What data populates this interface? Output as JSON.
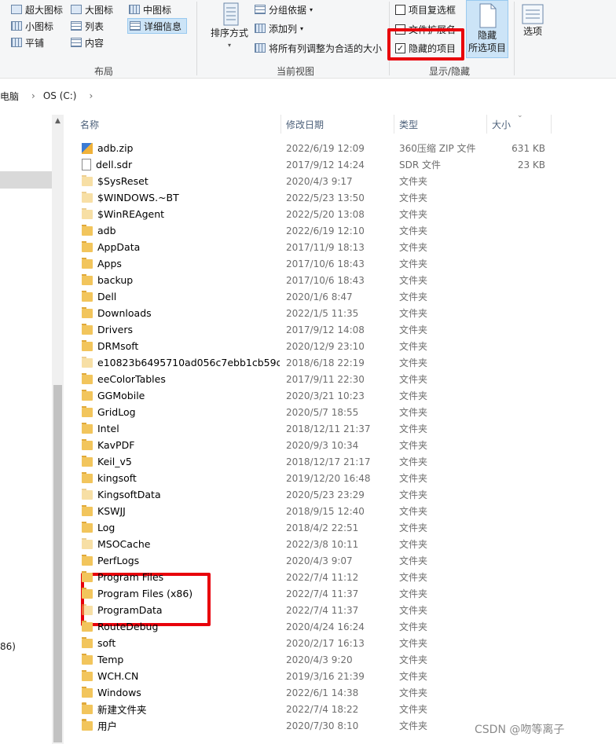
{
  "ribbon": {
    "layout": {
      "items": [
        "超大图标",
        "大图标",
        "中图标",
        "小图标",
        "列表",
        "详细信息",
        "平铺",
        "内容"
      ],
      "group_label": "布局"
    },
    "current_view": {
      "sort_label": "排序方式",
      "group_by": "分组依据",
      "add_column": "添加列",
      "fit_columns": "将所有列调整为合适的大小",
      "group_label": "当前视图"
    },
    "show_hide": {
      "item_checkboxes": "项目复选框",
      "file_extensions": "文件扩展名",
      "hidden_items": "隐藏的项目",
      "hidden_items_checked": "✓",
      "hide_selected_line1": "隐藏",
      "hide_selected_line2": "所选项目",
      "group_label": "显示/隐藏"
    },
    "options": "选项"
  },
  "address": {
    "crumbs": [
      "此电脑",
      "OS (C:)"
    ],
    "separator": "›"
  },
  "nav": {
    "partial_label": "86)"
  },
  "columns": {
    "name": "名称",
    "date": "修改日期",
    "type": "类型",
    "size": "大小"
  },
  "files": [
    {
      "name": "adb.zip",
      "date": "2022/6/19 12:09",
      "type": "360压缩 ZIP 文件",
      "size": "631 KB",
      "icon": "zip-icon"
    },
    {
      "name": "dell.sdr",
      "date": "2017/9/12 14:24",
      "type": "SDR 文件",
      "size": "23 KB",
      "icon": "file-icon"
    },
    {
      "name": "$SysReset",
      "date": "2020/4/3 9:17",
      "type": "文件夹",
      "size": "",
      "icon": "hidden-folder-icon"
    },
    {
      "name": "$WINDOWS.~BT",
      "date": "2022/5/23 13:50",
      "type": "文件夹",
      "size": "",
      "icon": "hidden-folder-icon"
    },
    {
      "name": "$WinREAgent",
      "date": "2022/5/20 13:08",
      "type": "文件夹",
      "size": "",
      "icon": "hidden-folder-icon"
    },
    {
      "name": "adb",
      "date": "2022/6/19 12:10",
      "type": "文件夹",
      "size": "",
      "icon": "folder-icon"
    },
    {
      "name": "AppData",
      "date": "2017/11/9 18:13",
      "type": "文件夹",
      "size": "",
      "icon": "folder-icon"
    },
    {
      "name": "Apps",
      "date": "2017/10/6 18:43",
      "type": "文件夹",
      "size": "",
      "icon": "folder-icon"
    },
    {
      "name": "backup",
      "date": "2017/10/6 18:43",
      "type": "文件夹",
      "size": "",
      "icon": "folder-icon"
    },
    {
      "name": "Dell",
      "date": "2020/1/6 8:47",
      "type": "文件夹",
      "size": "",
      "icon": "folder-icon"
    },
    {
      "name": "Downloads",
      "date": "2022/1/5 11:35",
      "type": "文件夹",
      "size": "",
      "icon": "folder-icon"
    },
    {
      "name": "Drivers",
      "date": "2017/9/12 14:08",
      "type": "文件夹",
      "size": "",
      "icon": "folder-icon"
    },
    {
      "name": "DRMsoft",
      "date": "2020/12/9 23:10",
      "type": "文件夹",
      "size": "",
      "icon": "folder-icon"
    },
    {
      "name": "e10823b6495710ad056c7ebb1cb59d...",
      "date": "2018/6/18 22:19",
      "type": "文件夹",
      "size": "",
      "icon": "hidden-folder-icon"
    },
    {
      "name": "eeColorTables",
      "date": "2017/9/11 22:30",
      "type": "文件夹",
      "size": "",
      "icon": "folder-icon"
    },
    {
      "name": "GGMobile",
      "date": "2020/3/21 10:23",
      "type": "文件夹",
      "size": "",
      "icon": "folder-icon"
    },
    {
      "name": "GridLog",
      "date": "2020/5/7 18:55",
      "type": "文件夹",
      "size": "",
      "icon": "folder-icon"
    },
    {
      "name": "Intel",
      "date": "2018/12/11 21:37",
      "type": "文件夹",
      "size": "",
      "icon": "folder-icon"
    },
    {
      "name": "KavPDF",
      "date": "2020/9/3 10:34",
      "type": "文件夹",
      "size": "",
      "icon": "folder-icon"
    },
    {
      "name": "Keil_v5",
      "date": "2018/12/17 21:17",
      "type": "文件夹",
      "size": "",
      "icon": "folder-icon"
    },
    {
      "name": "kingsoft",
      "date": "2019/12/20 16:48",
      "type": "文件夹",
      "size": "",
      "icon": "folder-icon"
    },
    {
      "name": "KingsoftData",
      "date": "2020/5/23 23:29",
      "type": "文件夹",
      "size": "",
      "icon": "hidden-folder-icon"
    },
    {
      "name": "KSWJJ",
      "date": "2018/9/15 12:40",
      "type": "文件夹",
      "size": "",
      "icon": "folder-icon"
    },
    {
      "name": "Log",
      "date": "2018/4/2 22:51",
      "type": "文件夹",
      "size": "",
      "icon": "folder-icon"
    },
    {
      "name": "MSOCache",
      "date": "2022/3/8 10:11",
      "type": "文件夹",
      "size": "",
      "icon": "hidden-folder-icon"
    },
    {
      "name": "PerfLogs",
      "date": "2020/4/3 9:07",
      "type": "文件夹",
      "size": "",
      "icon": "folder-icon"
    },
    {
      "name": "Program Files",
      "date": "2022/7/4 11:12",
      "type": "文件夹",
      "size": "",
      "icon": "folder-icon"
    },
    {
      "name": "Program Files (x86)",
      "date": "2022/7/4 11:37",
      "type": "文件夹",
      "size": "",
      "icon": "folder-icon"
    },
    {
      "name": "ProgramData",
      "date": "2022/7/4 11:37",
      "type": "文件夹",
      "size": "",
      "icon": "hidden-folder-icon"
    },
    {
      "name": "RouteDebug",
      "date": "2020/4/24 16:24",
      "type": "文件夹",
      "size": "",
      "icon": "folder-icon"
    },
    {
      "name": "soft",
      "date": "2020/2/17 16:13",
      "type": "文件夹",
      "size": "",
      "icon": "folder-icon"
    },
    {
      "name": "Temp",
      "date": "2020/4/3 9:20",
      "type": "文件夹",
      "size": "",
      "icon": "folder-icon"
    },
    {
      "name": "WCH.CN",
      "date": "2019/3/16 21:39",
      "type": "文件夹",
      "size": "",
      "icon": "folder-icon"
    },
    {
      "name": "Windows",
      "date": "2022/6/1 14:38",
      "type": "文件夹",
      "size": "",
      "icon": "folder-icon"
    },
    {
      "name": "新建文件夹",
      "date": "2022/7/4 18:22",
      "type": "文件夹",
      "size": "",
      "icon": "folder-icon"
    },
    {
      "name": "用户",
      "date": "2020/7/30 8:10",
      "type": "文件夹",
      "size": "",
      "icon": "folder-icon"
    }
  ],
  "watermark": "CSDN @吻等离子",
  "colors": {
    "highlight_red": "#e8000b",
    "folder_yellow": "#f2c55c",
    "selection_blue": "#cce4f7"
  }
}
